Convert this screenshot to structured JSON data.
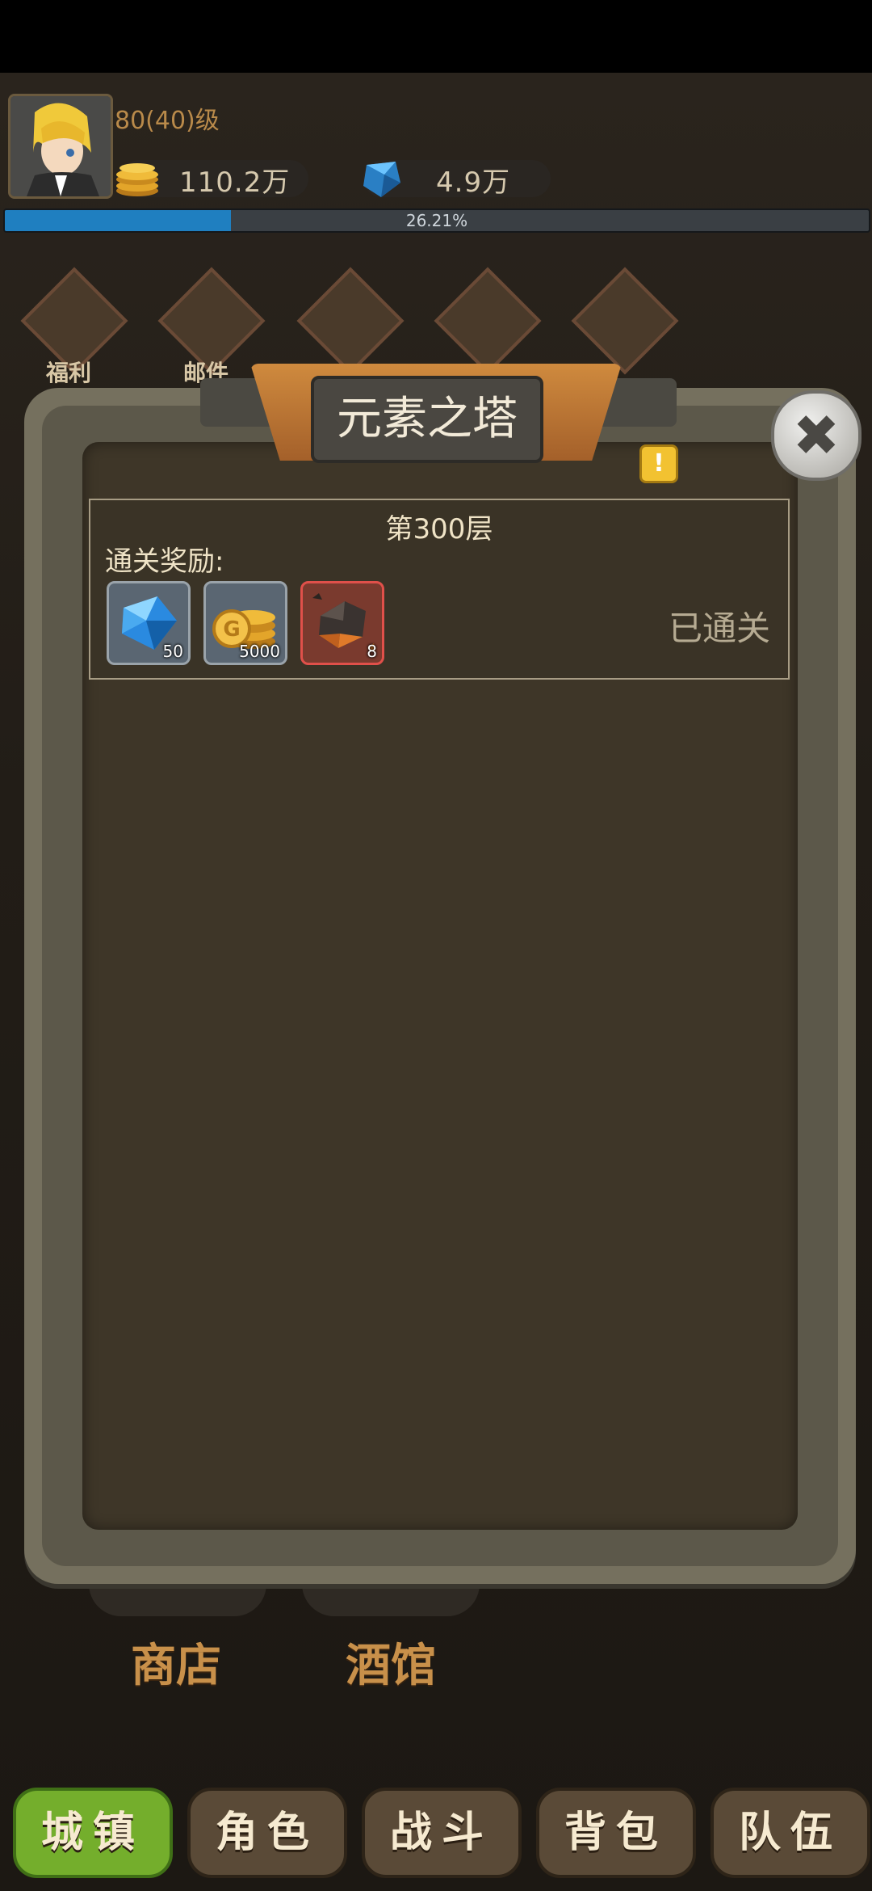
{
  "player": {
    "level_text": "80(40)级",
    "gold": "110.2万",
    "gems": "4.9万",
    "exp_percent_text": "26.21%",
    "exp_progress": 0.2621
  },
  "top_menu": [
    {
      "label": "福利",
      "icon": "winged-emblem-icon"
    },
    {
      "label": "邮件",
      "icon": "mail-envelope-icon"
    },
    {
      "label": "",
      "icon": "glove-icon"
    },
    {
      "label": "",
      "icon": "treasure-chest-icon"
    },
    {
      "label": "",
      "icon": "winged-emblem-icon"
    }
  ],
  "modal": {
    "title": "元素之塔",
    "floor": {
      "title": "第300层",
      "reward_label": "通关奖励:",
      "status": "已通关",
      "rewards": [
        {
          "icon": "blue-diamond-icon",
          "count": "50"
        },
        {
          "icon": "gold-coins-icon",
          "count": "5000"
        },
        {
          "icon": "ore-chunk-icon",
          "count": "8"
        }
      ]
    }
  },
  "town": {
    "buildings": [
      {
        "label": "商店"
      },
      {
        "label": "酒馆"
      }
    ]
  },
  "bottom_nav": [
    {
      "label": "城镇",
      "active": true
    },
    {
      "label": "角色",
      "active": false
    },
    {
      "label": "战斗",
      "active": false
    },
    {
      "label": "背包",
      "active": false
    },
    {
      "label": "队伍",
      "active": false
    }
  ],
  "colors": {
    "accent_green": "#74ae2c",
    "exp_blue": "#1f7fc0",
    "banner_orange": "#cf8a3e"
  }
}
